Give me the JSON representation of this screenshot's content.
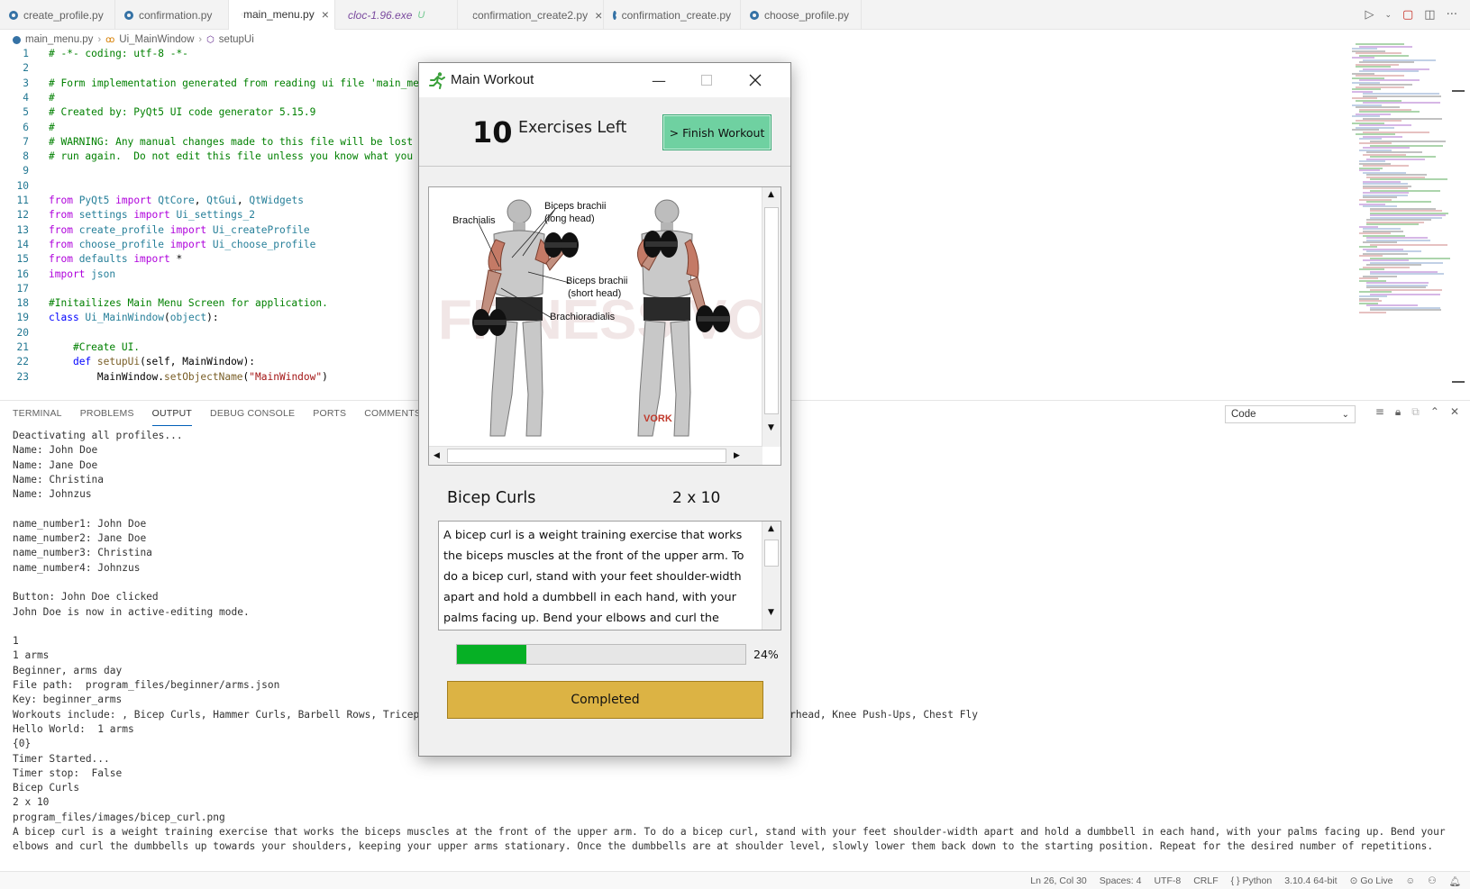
{
  "tabs": [
    {
      "label": "create_profile.py",
      "type": "py",
      "active": false
    },
    {
      "label": "confirmation.py",
      "type": "py",
      "active": false
    },
    {
      "label": "main_menu.py",
      "type": "py",
      "active": true
    },
    {
      "label": "cloc-1.96.exe",
      "type": "exe",
      "flag": "U",
      "active": false
    },
    {
      "label": "confirmation_create2.py",
      "type": "py",
      "active": false
    },
    {
      "label": "confirmation_create.py",
      "type": "py",
      "active": false
    },
    {
      "label": "choose_profile.py",
      "type": "py",
      "active": false
    }
  ],
  "breadcrumb": {
    "file": "main_menu.py",
    "class": "Ui_MainWindow",
    "method": "setupUi"
  },
  "code": [
    {
      "n": "1",
      "tokens": [
        [
          "c-com",
          "# -*- coding: utf-8 -*-"
        ]
      ]
    },
    {
      "n": "2",
      "tokens": []
    },
    {
      "n": "3",
      "tokens": [
        [
          "c-com",
          "# Form implementation generated from reading ui file 'main_menu.ui'"
        ]
      ]
    },
    {
      "n": "4",
      "tokens": [
        [
          "c-com",
          "#"
        ]
      ]
    },
    {
      "n": "5",
      "tokens": [
        [
          "c-com",
          "# Created by: PyQt5 UI code generator 5.15.9"
        ]
      ]
    },
    {
      "n": "6",
      "tokens": [
        [
          "c-com",
          "#"
        ]
      ]
    },
    {
      "n": "7",
      "tokens": [
        [
          "c-com",
          "# WARNING: Any manual changes made to this file will be lost"
        ]
      ]
    },
    {
      "n": "8",
      "tokens": [
        [
          "c-com",
          "# run again.  Do not edit this file unless you know what you"
        ]
      ]
    },
    {
      "n": "9",
      "tokens": []
    },
    {
      "n": "10",
      "tokens": []
    },
    {
      "n": "11",
      "tokens": [
        [
          "c-kw",
          "from "
        ],
        [
          "c-mod",
          "PyQt5 "
        ],
        [
          "c-kw",
          "import "
        ],
        [
          "c-mod",
          "QtCore"
        ],
        [
          "c-txt",
          ", "
        ],
        [
          "c-mod",
          "QtGui"
        ],
        [
          "c-txt",
          ", "
        ],
        [
          "c-mod",
          "QtWidgets"
        ]
      ]
    },
    {
      "n": "12",
      "tokens": [
        [
          "c-kw",
          "from "
        ],
        [
          "c-mod",
          "settings "
        ],
        [
          "c-kw",
          "import "
        ],
        [
          "c-mod",
          "Ui_settings_2"
        ]
      ]
    },
    {
      "n": "13",
      "tokens": [
        [
          "c-kw",
          "from "
        ],
        [
          "c-mod",
          "create_profile "
        ],
        [
          "c-kw",
          "import "
        ],
        [
          "c-mod",
          "Ui_createProfile"
        ]
      ]
    },
    {
      "n": "14",
      "tokens": [
        [
          "c-kw",
          "from "
        ],
        [
          "c-mod",
          "choose_profile "
        ],
        [
          "c-kw",
          "import "
        ],
        [
          "c-mod",
          "Ui_choose_profile"
        ]
      ]
    },
    {
      "n": "15",
      "tokens": [
        [
          "c-kw",
          "from "
        ],
        [
          "c-mod",
          "defaults "
        ],
        [
          "c-kw",
          "import "
        ],
        [
          "c-txt",
          "*"
        ]
      ]
    },
    {
      "n": "16",
      "tokens": [
        [
          "c-kw",
          "import "
        ],
        [
          "c-mod",
          "json"
        ]
      ]
    },
    {
      "n": "17",
      "tokens": []
    },
    {
      "n": "18",
      "tokens": [
        [
          "c-com",
          "#Initailizes Main Menu Screen for application."
        ]
      ]
    },
    {
      "n": "19",
      "tokens": [
        [
          "c-kw2",
          "class "
        ],
        [
          "c-mod",
          "Ui_MainWindow"
        ],
        [
          "c-txt",
          "("
        ],
        [
          "c-mod",
          "object"
        ],
        [
          "c-txt",
          "):"
        ]
      ]
    },
    {
      "n": "20",
      "tokens": []
    },
    {
      "n": "21",
      "tokens": [
        [
          "c-txt",
          "    "
        ],
        [
          "c-com",
          "#Create UI."
        ]
      ]
    },
    {
      "n": "22",
      "tokens": [
        [
          "c-txt",
          "    "
        ],
        [
          "c-kw2",
          "def "
        ],
        [
          "c-fn",
          "setupUi"
        ],
        [
          "c-txt",
          "(self, MainWindow):"
        ]
      ]
    },
    {
      "n": "23",
      "tokens": [
        [
          "c-txt",
          "        MainWindow."
        ],
        [
          "c-fn",
          "setObjectName"
        ],
        [
          "c-txt",
          "("
        ],
        [
          "c-str",
          "\"MainWindow\""
        ],
        [
          "c-txt",
          ")"
        ]
      ]
    },
    {
      "n": "24",
      "tokens": []
    }
  ],
  "panel": {
    "tabs": [
      "TERMINAL",
      "PROBLEMS",
      "OUTPUT",
      "DEBUG CONSOLE",
      "PORTS",
      "COMMENTS"
    ],
    "active_tab": "OUTPUT",
    "output_channel": "Code"
  },
  "output_lines": [
    "Deactivating all profiles...",
    "Name: John Doe",
    "Name: Jane Doe",
    "Name: Christina",
    "Name: Johnzus",
    "",
    "name_number1: John Doe",
    "name_number2: Jane Doe",
    "name_number3: Christina",
    "name_number4: Johnzus",
    "",
    "Button: John Doe clicked",
    "John Doe is now in active-editing mode.",
    "",
    "1",
    "1 arms",
    "Beginner, arms day",
    "File path:  program_files/beginner/arms.json",
    "Key: beginner_arms",
    "Workouts include: , Bicep Curls, Hammer Curls, Barbell Rows, Tricep                                               s, Barbell Overhead, Knee Push-Ups, Chest Fly",
    "Hello World:  1 arms",
    "{0}",
    "Timer Started...",
    "Timer stop:  False",
    "Bicep Curls",
    "2 x 10",
    "program_files/images/bicep_curl.png",
    "A bicep curl is a weight training exercise that works the biceps muscles at the front of the upper arm. To do a bicep curl, stand with your feet shoulder-width apart and hold a dumbbell in each hand, with your palms facing up. Bend your",
    "elbows and curl the dumbbells up towards your shoulders, keeping your upper arms stationary. Once the dumbbells are at shoulder level, slowly lower them back down to the starting position. Repeat for the desired number of repetitions."
  ],
  "status": {
    "position": "Ln 26, Col 30",
    "spaces": "Spaces: 4",
    "encoding": "UTF-8",
    "eol": "CRLF",
    "language": "Python",
    "interpreter": "3.10.4 64-bit",
    "golive": "Go Live"
  },
  "workout": {
    "window_title": "Main Workout",
    "exercises_left_count": "10",
    "exercises_left_label": "Exercises Left",
    "finish_button": "> Finish Workout",
    "image_labels": {
      "brachialis": "Brachialis",
      "biceps_long_1": "Biceps brachii",
      "biceps_long_2": "(long head)",
      "biceps_short_1": "Biceps brachii",
      "biceps_short_2": "(short head)",
      "brachioradialis": "Brachioradialis",
      "watermark": "FITNESS VOLT",
      "corner_mark": "VORK"
    },
    "exercise_name": "Bicep Curls",
    "sets_reps": "2 x 10",
    "description": "A bicep curl is a weight training exercise that works the biceps muscles at the front of the upper arm. To do a bicep curl, stand with your feet shoulder-width apart and hold a dumbbell in each hand, with your palms facing up. Bend your elbows and curl the dumbbells up towards your shoulders, keeping your upper arms stationary.",
    "progress_fraction": 0.24,
    "progress_text": "24%",
    "completed_button": "Completed",
    "colors": {
      "finish_button": "#6fd1a1",
      "progress_fill": "#06b025",
      "completed_button": "#dcb344"
    }
  }
}
